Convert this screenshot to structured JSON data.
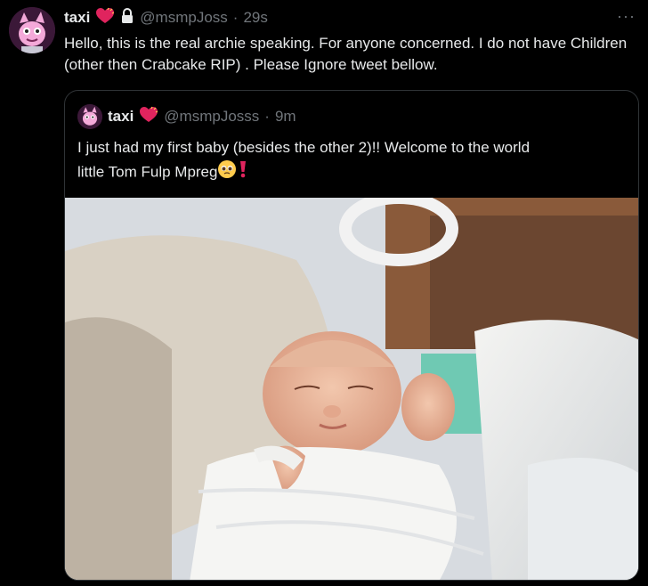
{
  "tweet": {
    "name": "taxi",
    "handle": "@msmpJoss",
    "separator": "·",
    "time": "29s",
    "more_label": "···",
    "text": "Hello, this is the real archie speaking. For anyone concerned.  I do not have Children (other then Crabcake RIP) . Please Ignore tweet bellow."
  },
  "quote": {
    "name": "taxi",
    "handle": "@msmpJosss",
    "separator": "·",
    "time": "9m",
    "text_line1": "I just had my first baby (besides the other 2)!! Welcome to the world",
    "text_line2": "little Tom Fulp Mpreg"
  },
  "colors": {
    "background": "#000000",
    "text": "#e7e9ea",
    "muted": "#71767b",
    "border": "#2f3336",
    "heart": "#f91880"
  }
}
